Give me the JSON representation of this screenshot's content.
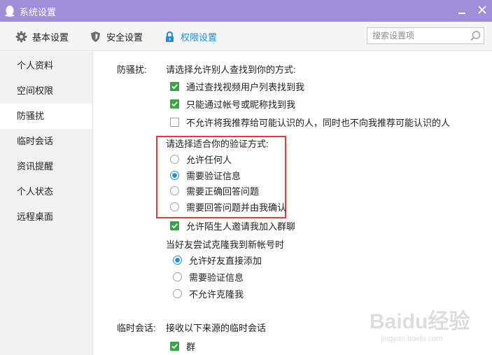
{
  "window": {
    "title": "系统设置"
  },
  "toolbar": {
    "tabs": [
      {
        "label": "基本设置",
        "icon": "gear-icon",
        "active": false
      },
      {
        "label": "安全设置",
        "icon": "shield-icon",
        "active": false
      },
      {
        "label": "权限设置",
        "icon": "lock-icon",
        "active": true
      }
    ],
    "search": {
      "placeholder": "搜索设置项",
      "value": ""
    },
    "accent_color": "#1e8ee0"
  },
  "sidebar": {
    "items": [
      {
        "label": "个人资料",
        "selected": false
      },
      {
        "label": "空间权限",
        "selected": false
      },
      {
        "label": "防骚扰",
        "selected": true
      },
      {
        "label": "临时会话",
        "selected": false
      },
      {
        "label": "资讯提醒",
        "selected": false
      },
      {
        "label": "个人状态",
        "selected": false
      },
      {
        "label": "远程桌面",
        "selected": false
      }
    ]
  },
  "anti_harass": {
    "section_label": "防骚扰:",
    "find_heading": "请选择允许别人查找到你的方式:",
    "find_options": [
      {
        "label": "通过查找视频用户列表找到我",
        "checked": true
      },
      {
        "label": "只能通过帐号或昵称找到我",
        "checked": true
      },
      {
        "label": "不允许将我推荐给可能认识的人，同时也不向我推荐可能认识的人",
        "checked": false
      }
    ],
    "verify_heading": "请选择适合你的验证方式:",
    "verify_options": [
      {
        "label": "允许任何人",
        "selected": false
      },
      {
        "label": "需要验证信息",
        "selected": true
      },
      {
        "label": "需要正确回答问题",
        "selected": false
      },
      {
        "label": "需要回答问题并由我确认",
        "selected": false
      }
    ],
    "group_invite": {
      "label": "允许陌生人邀请我加入群聊",
      "checked": true
    },
    "clone_heading": "当好友尝试克隆我到新帐号时",
    "clone_options": [
      {
        "label": "允许好友直接添加",
        "selected": true
      },
      {
        "label": "需要验证信息",
        "selected": false
      },
      {
        "label": "不允许克隆我",
        "selected": false
      }
    ]
  },
  "temp_chat": {
    "section_label": "临时会话:",
    "heading": "接收以下来源的临时会话",
    "options": [
      {
        "label": "群",
        "checked": true
      }
    ]
  },
  "watermark": {
    "main": "Baidu经验",
    "sub": "jingyan.baidu.com"
  },
  "colors": {
    "titlebar": "#a08fd8",
    "check_green": "#3aa545",
    "radio_blue": "#1e8ee0",
    "highlight_red": "#e53935"
  }
}
